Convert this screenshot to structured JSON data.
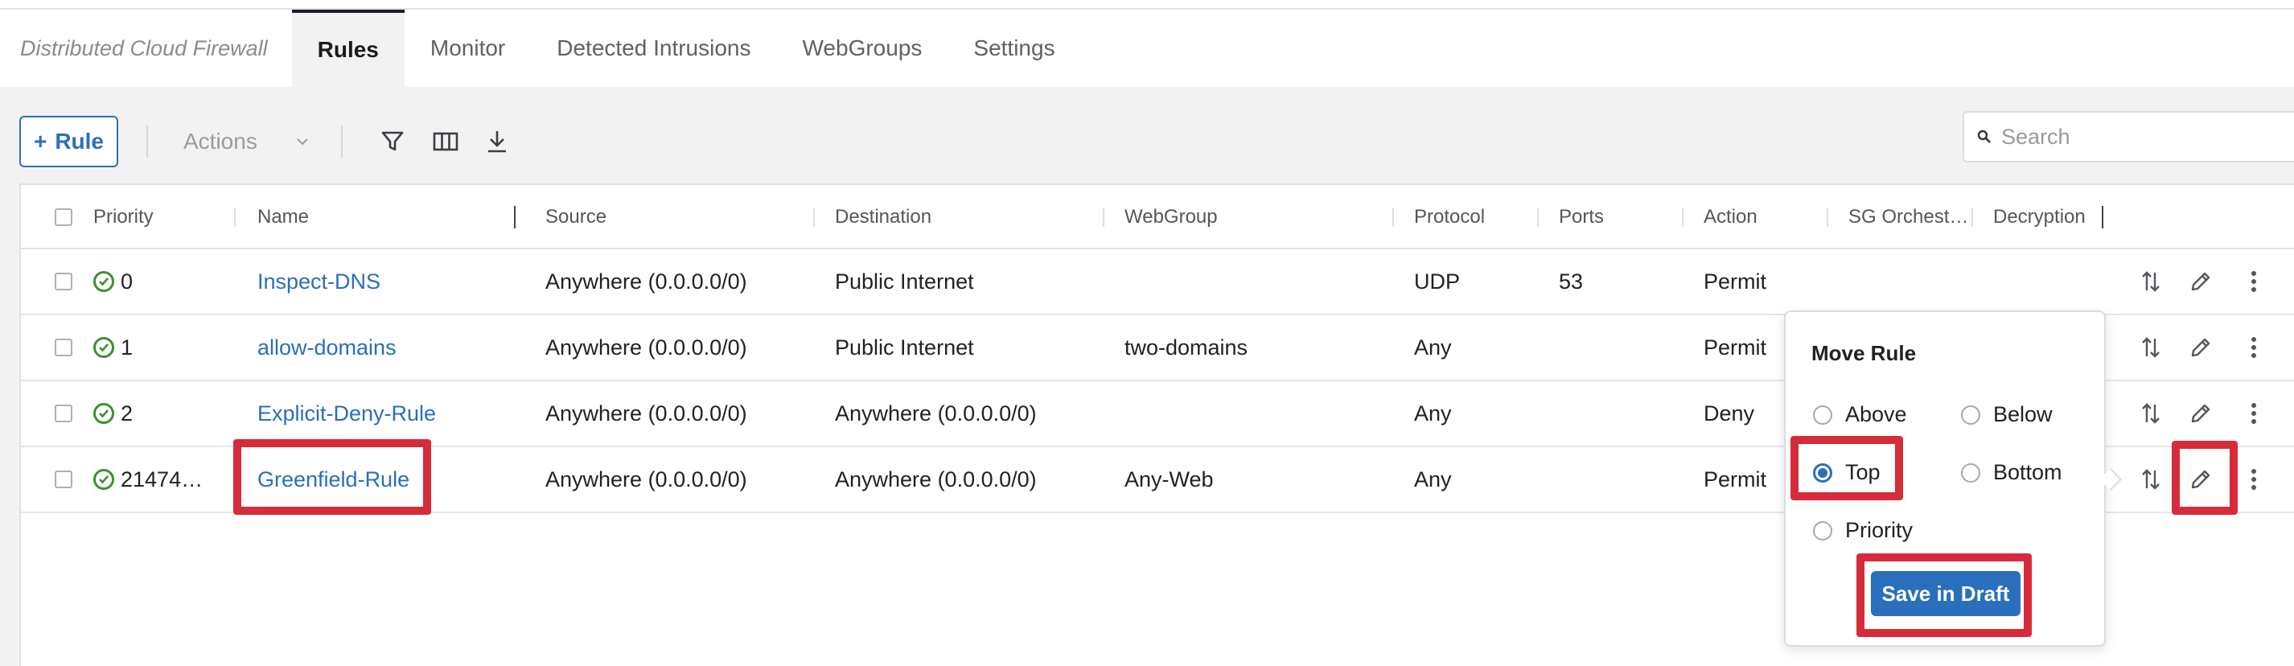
{
  "app": {
    "breadcrumb": "Distributed Cloud Firewall"
  },
  "tabs": [
    {
      "label": "Rules",
      "active": true
    },
    {
      "label": "Monitor"
    },
    {
      "label": "Detected Intrusions"
    },
    {
      "label": "WebGroups"
    },
    {
      "label": "Settings"
    }
  ],
  "toolbar": {
    "add_rule_label": "Rule",
    "actions_label": "Actions",
    "search_placeholder": "Search",
    "icons": [
      "filter-icon",
      "columns-icon",
      "download-icon"
    ]
  },
  "table": {
    "columns": [
      "Priority",
      "Name",
      "Source",
      "Destination",
      "WebGroup",
      "Protocol",
      "Ports",
      "Action",
      "SG Orchest…",
      "Decryption"
    ],
    "rows": [
      {
        "priority": "0",
        "name": "Inspect-DNS",
        "source": "Anywhere (0.0.0.0/0)",
        "destination": "Public Internet",
        "webgroup": "",
        "protocol": "UDP",
        "ports": "53",
        "action": "Permit"
      },
      {
        "priority": "1",
        "name": "allow-domains",
        "source": "Anywhere (0.0.0.0/0)",
        "destination": "Public Internet",
        "webgroup": "two-domains",
        "protocol": "Any",
        "ports": "",
        "action": "Permit"
      },
      {
        "priority": "2",
        "name": "Explicit-Deny-Rule",
        "source": "Anywhere (0.0.0.0/0)",
        "destination": "Anywhere (0.0.0.0/0)",
        "webgroup": "",
        "protocol": "Any",
        "ports": "",
        "action": "Deny"
      },
      {
        "priority": "21474…",
        "name": "Greenfield-Rule",
        "source": "Anywhere (0.0.0.0/0)",
        "destination": "Anywhere (0.0.0.0/0)",
        "webgroup": "Any-Web",
        "protocol": "Any",
        "ports": "",
        "action": "Permit"
      }
    ]
  },
  "move_rule": {
    "title": "Move Rule",
    "options": {
      "above": "Above",
      "below": "Below",
      "top": "Top",
      "bottom": "Bottom",
      "priority": "Priority"
    },
    "selected": "Top",
    "save_label": "Save in Draft"
  },
  "colors": {
    "accent": "#2a6fbb",
    "highlight": "#d72b3a",
    "success": "#3f8f2f"
  }
}
